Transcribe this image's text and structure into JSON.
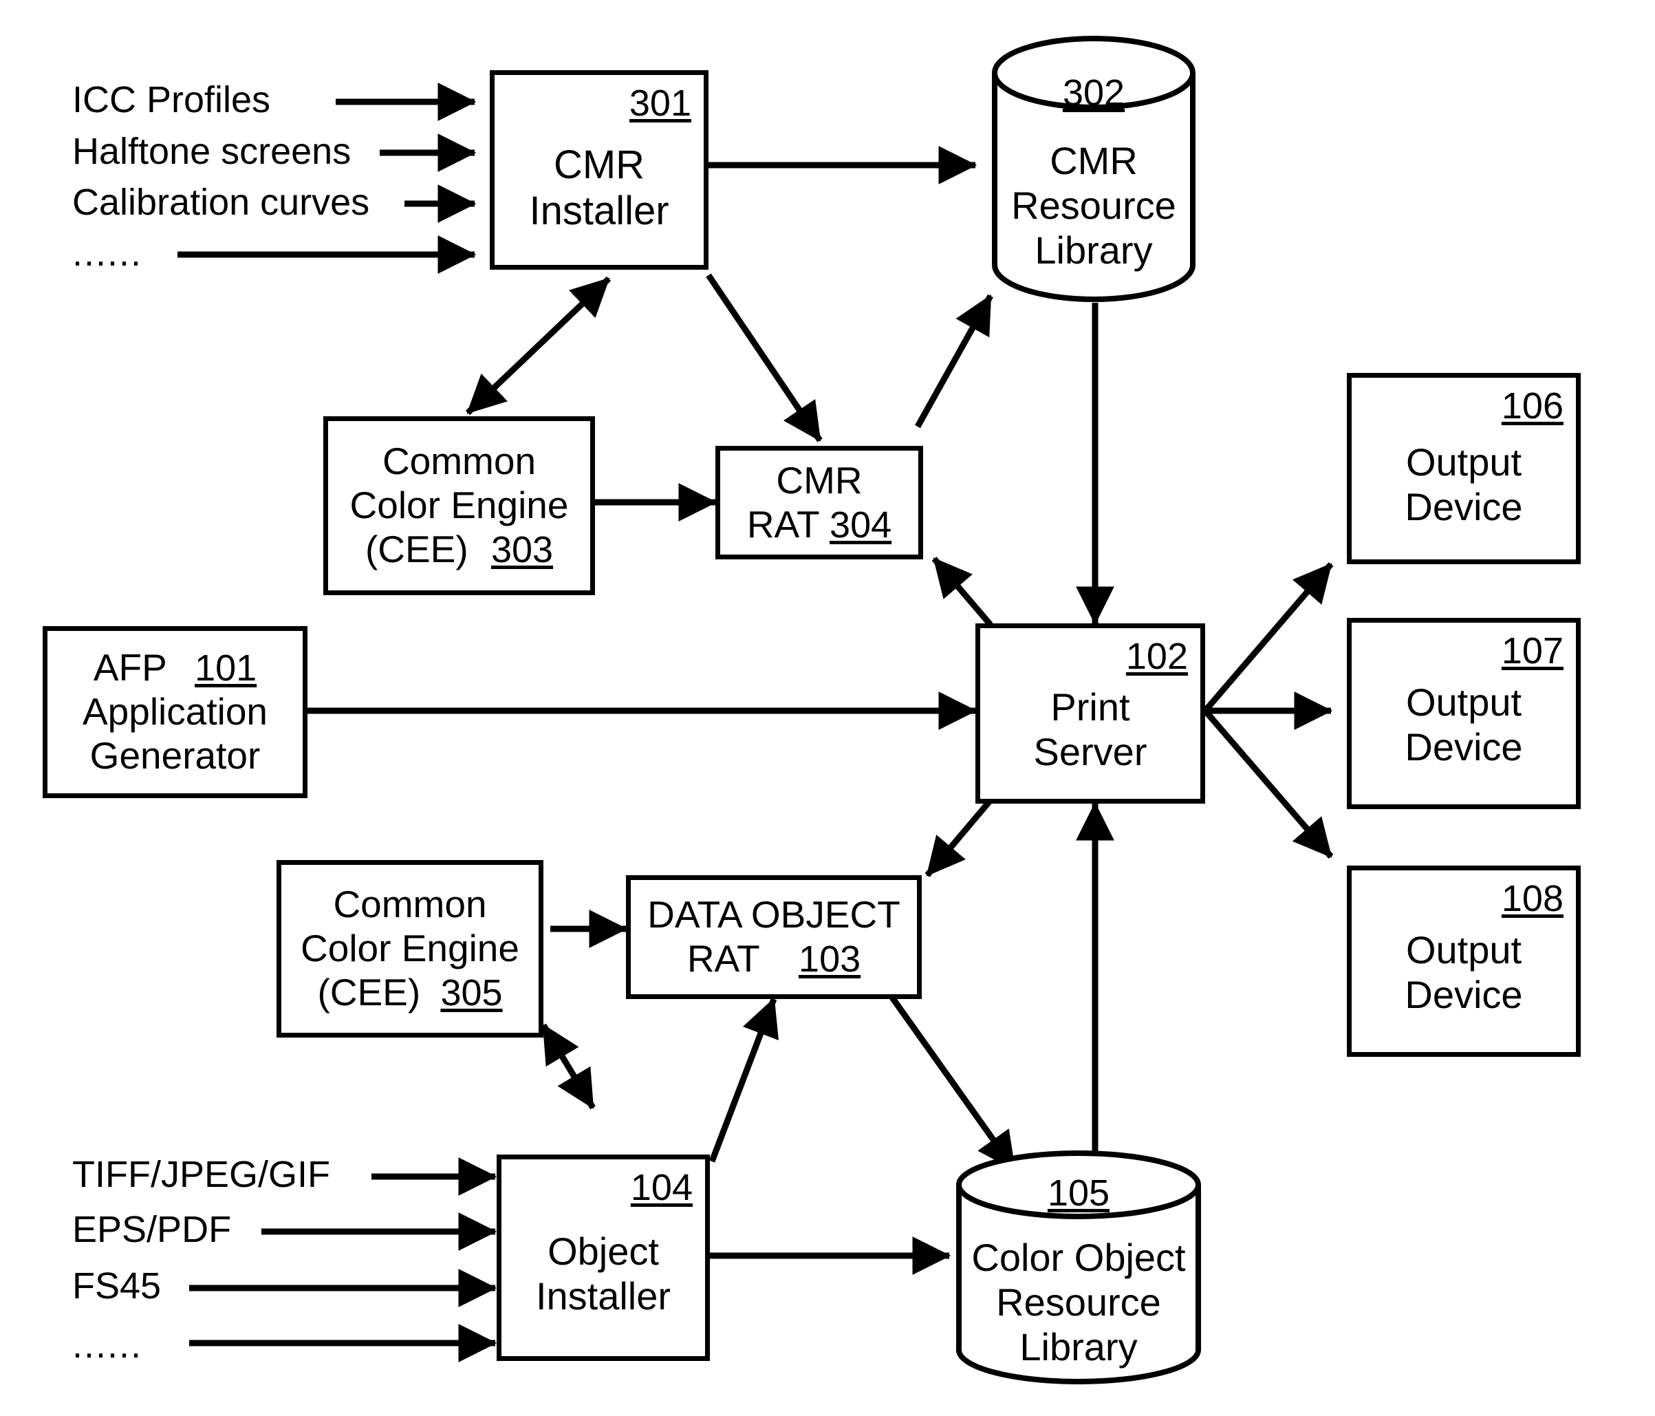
{
  "figure": {
    "type": "block-diagram",
    "background": "#ffffff",
    "stroke": "#000000"
  },
  "inputs_top": [
    {
      "label": "ICC Profiles"
    },
    {
      "label": "Halftone screens"
    },
    {
      "label": "Calibration curves"
    },
    {
      "label": "......"
    }
  ],
  "inputs_bottom": [
    {
      "label": "TIFF/JPEG/GIF"
    },
    {
      "label": "EPS/PDF"
    },
    {
      "label": "FS45"
    },
    {
      "label": "......"
    }
  ],
  "nodes": {
    "cmr_installer": {
      "ref": "301",
      "line1": "CMR",
      "line2": "Installer",
      "shape": "rect"
    },
    "cmr_resource_library": {
      "ref": "302",
      "line1": "CMR",
      "line2": "Resource",
      "line3": "Library",
      "shape": "cylinder"
    },
    "cee_303": {
      "ref": "303",
      "line1": "Common",
      "line2": "Color Engine",
      "line3": "(CEE)",
      "shape": "rect"
    },
    "cmr_rat_304": {
      "ref": "304",
      "line1": "CMR",
      "line2": "RAT",
      "shape": "rect"
    },
    "afp_generator_101": {
      "ref": "101",
      "line1": "AFP",
      "line2": "Application",
      "line3": "Generator",
      "shape": "rect"
    },
    "print_server_102": {
      "ref": "102",
      "line1": "Print",
      "line2": "Server",
      "shape": "rect"
    },
    "output_device_106": {
      "ref": "106",
      "line1": "Output",
      "line2": "Device",
      "shape": "rect"
    },
    "output_device_107": {
      "ref": "107",
      "line1": "Output",
      "line2": "Device",
      "shape": "rect"
    },
    "output_device_108": {
      "ref": "108",
      "line1": "Output",
      "line2": "Device",
      "shape": "rect"
    },
    "cee_305": {
      "ref": "305",
      "line1": "Common",
      "line2": "Color Engine",
      "line3": "(CEE)",
      "shape": "rect"
    },
    "data_object_rat_103": {
      "ref": "103",
      "line1": "DATA OBJECT",
      "line2": "RAT",
      "shape": "rect"
    },
    "object_installer_104": {
      "ref": "104",
      "line1": "Object",
      "line2": "Installer",
      "shape": "rect"
    },
    "color_object_resource_library_105": {
      "ref": "105",
      "line1": "Color Object",
      "line2": "Resource",
      "line3": "Library",
      "shape": "cylinder"
    }
  },
  "edges": [
    {
      "from": "ICC Profiles",
      "to": "301",
      "style": "arrow"
    },
    {
      "from": "Halftone screens",
      "to": "301",
      "style": "arrow"
    },
    {
      "from": "Calibration curves",
      "to": "301",
      "style": "arrow"
    },
    {
      "from": "......",
      "to": "301",
      "style": "arrow"
    },
    {
      "from": "301",
      "to": "302",
      "style": "arrow"
    },
    {
      "from": "301",
      "to": "303",
      "style": "double-arrow"
    },
    {
      "from": "301",
      "to": "304",
      "style": "arrow"
    },
    {
      "from": "303",
      "to": "304",
      "style": "arrow"
    },
    {
      "from": "304",
      "to": "302",
      "style": "arrow"
    },
    {
      "from": "302",
      "to": "102",
      "style": "arrow"
    },
    {
      "from": "102",
      "to": "304",
      "style": "arrow"
    },
    {
      "from": "101",
      "to": "102",
      "style": "arrow"
    },
    {
      "from": "102",
      "to": "106",
      "style": "arrow"
    },
    {
      "from": "102",
      "to": "107",
      "style": "arrow"
    },
    {
      "from": "102",
      "to": "108",
      "style": "arrow"
    },
    {
      "from": "102",
      "to": "103",
      "style": "arrow"
    },
    {
      "from": "305",
      "to": "103",
      "style": "arrow"
    },
    {
      "from": "305",
      "to": "104",
      "style": "double-arrow"
    },
    {
      "from": "104",
      "to": "103",
      "style": "arrow"
    },
    {
      "from": "103",
      "to": "105",
      "style": "arrow"
    },
    {
      "from": "104",
      "to": "105",
      "style": "arrow"
    },
    {
      "from": "105",
      "to": "102",
      "style": "arrow"
    },
    {
      "from": "TIFF/JPEG/GIF",
      "to": "104",
      "style": "arrow"
    },
    {
      "from": "EPS/PDF",
      "to": "104",
      "style": "arrow"
    },
    {
      "from": "FS45",
      "to": "104",
      "style": "arrow"
    },
    {
      "from": "......",
      "to": "104",
      "style": "arrow"
    }
  ]
}
